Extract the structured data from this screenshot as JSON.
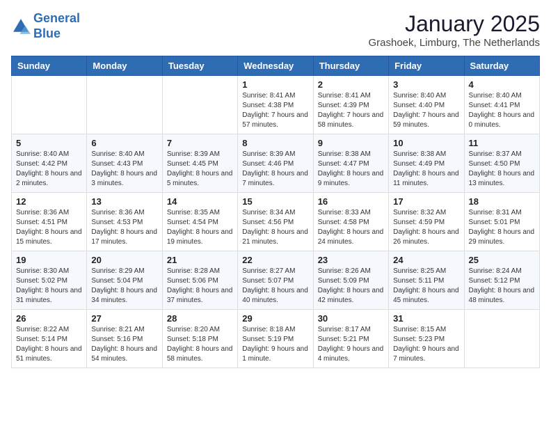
{
  "logo": {
    "line1": "General",
    "line2": "Blue"
  },
  "title": "January 2025",
  "subtitle": "Grashoek, Limburg, The Netherlands",
  "days_of_week": [
    "Sunday",
    "Monday",
    "Tuesday",
    "Wednesday",
    "Thursday",
    "Friday",
    "Saturday"
  ],
  "weeks": [
    [
      {
        "day": "",
        "info": ""
      },
      {
        "day": "",
        "info": ""
      },
      {
        "day": "",
        "info": ""
      },
      {
        "day": "1",
        "info": "Sunrise: 8:41 AM\nSunset: 4:38 PM\nDaylight: 7 hours and 57 minutes."
      },
      {
        "day": "2",
        "info": "Sunrise: 8:41 AM\nSunset: 4:39 PM\nDaylight: 7 hours and 58 minutes."
      },
      {
        "day": "3",
        "info": "Sunrise: 8:40 AM\nSunset: 4:40 PM\nDaylight: 7 hours and 59 minutes."
      },
      {
        "day": "4",
        "info": "Sunrise: 8:40 AM\nSunset: 4:41 PM\nDaylight: 8 hours and 0 minutes."
      }
    ],
    [
      {
        "day": "5",
        "info": "Sunrise: 8:40 AM\nSunset: 4:42 PM\nDaylight: 8 hours and 2 minutes."
      },
      {
        "day": "6",
        "info": "Sunrise: 8:40 AM\nSunset: 4:43 PM\nDaylight: 8 hours and 3 minutes."
      },
      {
        "day": "7",
        "info": "Sunrise: 8:39 AM\nSunset: 4:45 PM\nDaylight: 8 hours and 5 minutes."
      },
      {
        "day": "8",
        "info": "Sunrise: 8:39 AM\nSunset: 4:46 PM\nDaylight: 8 hours and 7 minutes."
      },
      {
        "day": "9",
        "info": "Sunrise: 8:38 AM\nSunset: 4:47 PM\nDaylight: 8 hours and 9 minutes."
      },
      {
        "day": "10",
        "info": "Sunrise: 8:38 AM\nSunset: 4:49 PM\nDaylight: 8 hours and 11 minutes."
      },
      {
        "day": "11",
        "info": "Sunrise: 8:37 AM\nSunset: 4:50 PM\nDaylight: 8 hours and 13 minutes."
      }
    ],
    [
      {
        "day": "12",
        "info": "Sunrise: 8:36 AM\nSunset: 4:51 PM\nDaylight: 8 hours and 15 minutes."
      },
      {
        "day": "13",
        "info": "Sunrise: 8:36 AM\nSunset: 4:53 PM\nDaylight: 8 hours and 17 minutes."
      },
      {
        "day": "14",
        "info": "Sunrise: 8:35 AM\nSunset: 4:54 PM\nDaylight: 8 hours and 19 minutes."
      },
      {
        "day": "15",
        "info": "Sunrise: 8:34 AM\nSunset: 4:56 PM\nDaylight: 8 hours and 21 minutes."
      },
      {
        "day": "16",
        "info": "Sunrise: 8:33 AM\nSunset: 4:58 PM\nDaylight: 8 hours and 24 minutes."
      },
      {
        "day": "17",
        "info": "Sunrise: 8:32 AM\nSunset: 4:59 PM\nDaylight: 8 hours and 26 minutes."
      },
      {
        "day": "18",
        "info": "Sunrise: 8:31 AM\nSunset: 5:01 PM\nDaylight: 8 hours and 29 minutes."
      }
    ],
    [
      {
        "day": "19",
        "info": "Sunrise: 8:30 AM\nSunset: 5:02 PM\nDaylight: 8 hours and 31 minutes."
      },
      {
        "day": "20",
        "info": "Sunrise: 8:29 AM\nSunset: 5:04 PM\nDaylight: 8 hours and 34 minutes."
      },
      {
        "day": "21",
        "info": "Sunrise: 8:28 AM\nSunset: 5:06 PM\nDaylight: 8 hours and 37 minutes."
      },
      {
        "day": "22",
        "info": "Sunrise: 8:27 AM\nSunset: 5:07 PM\nDaylight: 8 hours and 40 minutes."
      },
      {
        "day": "23",
        "info": "Sunrise: 8:26 AM\nSunset: 5:09 PM\nDaylight: 8 hours and 42 minutes."
      },
      {
        "day": "24",
        "info": "Sunrise: 8:25 AM\nSunset: 5:11 PM\nDaylight: 8 hours and 45 minutes."
      },
      {
        "day": "25",
        "info": "Sunrise: 8:24 AM\nSunset: 5:12 PM\nDaylight: 8 hours and 48 minutes."
      }
    ],
    [
      {
        "day": "26",
        "info": "Sunrise: 8:22 AM\nSunset: 5:14 PM\nDaylight: 8 hours and 51 minutes."
      },
      {
        "day": "27",
        "info": "Sunrise: 8:21 AM\nSunset: 5:16 PM\nDaylight: 8 hours and 54 minutes."
      },
      {
        "day": "28",
        "info": "Sunrise: 8:20 AM\nSunset: 5:18 PM\nDaylight: 8 hours and 58 minutes."
      },
      {
        "day": "29",
        "info": "Sunrise: 8:18 AM\nSunset: 5:19 PM\nDaylight: 9 hours and 1 minute."
      },
      {
        "day": "30",
        "info": "Sunrise: 8:17 AM\nSunset: 5:21 PM\nDaylight: 9 hours and 4 minutes."
      },
      {
        "day": "31",
        "info": "Sunrise: 8:15 AM\nSunset: 5:23 PM\nDaylight: 9 hours and 7 minutes."
      },
      {
        "day": "",
        "info": ""
      }
    ]
  ]
}
